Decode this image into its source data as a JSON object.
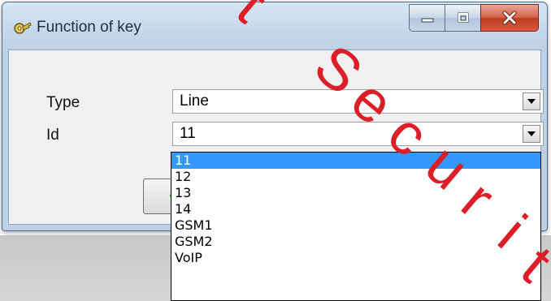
{
  "window": {
    "title": "Function of key",
    "icon": "keys-icon"
  },
  "caption_buttons": {
    "minimize_icon": "minimize-icon",
    "maximize_icon": "maximize-icon",
    "close_icon": "close-icon"
  },
  "form": {
    "type_label": "Type",
    "type_value": "Line",
    "id_label": "Id",
    "id_value": "11"
  },
  "ok_button": {
    "icon": "checkmark-icon",
    "accent_color": "#2e9e1e"
  },
  "id_dropdown": {
    "selected_index": 0,
    "options": [
      "11",
      "12",
      "13",
      "14",
      "GSM1",
      "GSM2",
      "VoIP"
    ],
    "highlight_color": "#3399ff"
  },
  "watermark": {
    "visible_text": "t Securit",
    "color": "#dc1e28"
  },
  "colors": {
    "title_bar": "#c3d6ea",
    "close_button": "#c74a34",
    "client_area": "#f0f0f0"
  }
}
